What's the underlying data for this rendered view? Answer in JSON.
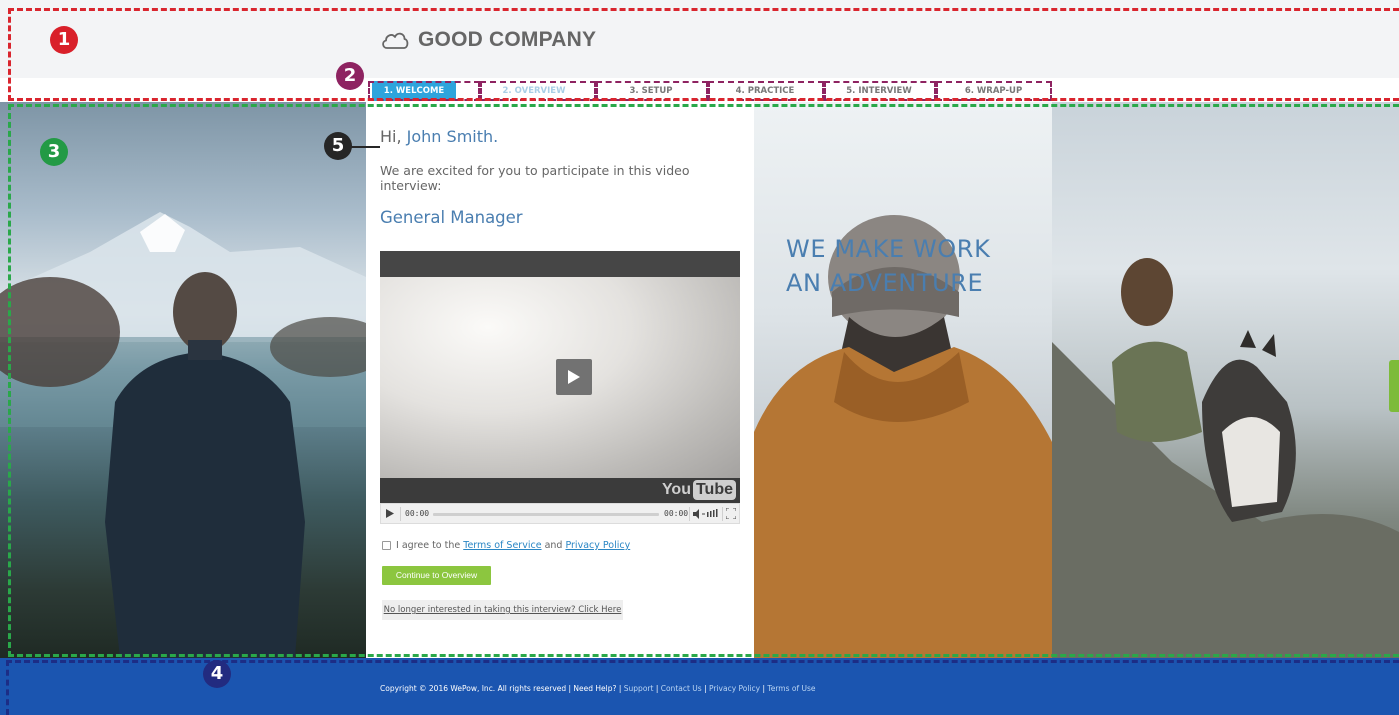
{
  "header": {
    "company_name": "GOOD COMPANY",
    "logo_icon": "cloud-icon",
    "steps": [
      {
        "label": "1. WELCOME",
        "state": "active"
      },
      {
        "label": "2. OVERVIEW",
        "state": "pending"
      },
      {
        "label": "3. SETUP",
        "state": "default"
      },
      {
        "label": "4. PRACTICE",
        "state": "default"
      },
      {
        "label": "5. INTERVIEW",
        "state": "default"
      },
      {
        "label": "6. WRAP-UP",
        "state": "default"
      }
    ]
  },
  "welcome": {
    "greeting_prefix": "Hi, ",
    "candidate_name": "John Smith.",
    "intro": "We are excited for you to participate in this video interview:",
    "job_title": "General Manager"
  },
  "video": {
    "current_time": "00:00",
    "duration": "00:00",
    "brand_you": "You",
    "brand_tube": "Tube"
  },
  "agreement": {
    "prefix": "I agree to the ",
    "terms_label": "Terms of Service",
    "and": " and ",
    "privacy_label": "Privacy Policy"
  },
  "actions": {
    "continue_label": "Continue to Overview",
    "decline_label": "No longer interested in taking this interview? Click Here"
  },
  "tagline": {
    "line1": "WE MAKE WORK",
    "line2": "AN ADVENTURE"
  },
  "footer": {
    "copyright": "Copyright © 2016 WePow, Inc. All rights reserved  | Need Help? | ",
    "links": [
      "Support",
      "Contact Us",
      "Privacy Policy",
      "Terms of Use"
    ],
    "separator": " | "
  },
  "annotations": {
    "markers": [
      "1",
      "2",
      "3",
      "4",
      "5"
    ]
  },
  "colors": {
    "accent_blue": "#2ea4dc",
    "heading_blue": "#4a7eb0",
    "button_green": "#8cc63f",
    "footer_blue": "#1b55b0"
  }
}
